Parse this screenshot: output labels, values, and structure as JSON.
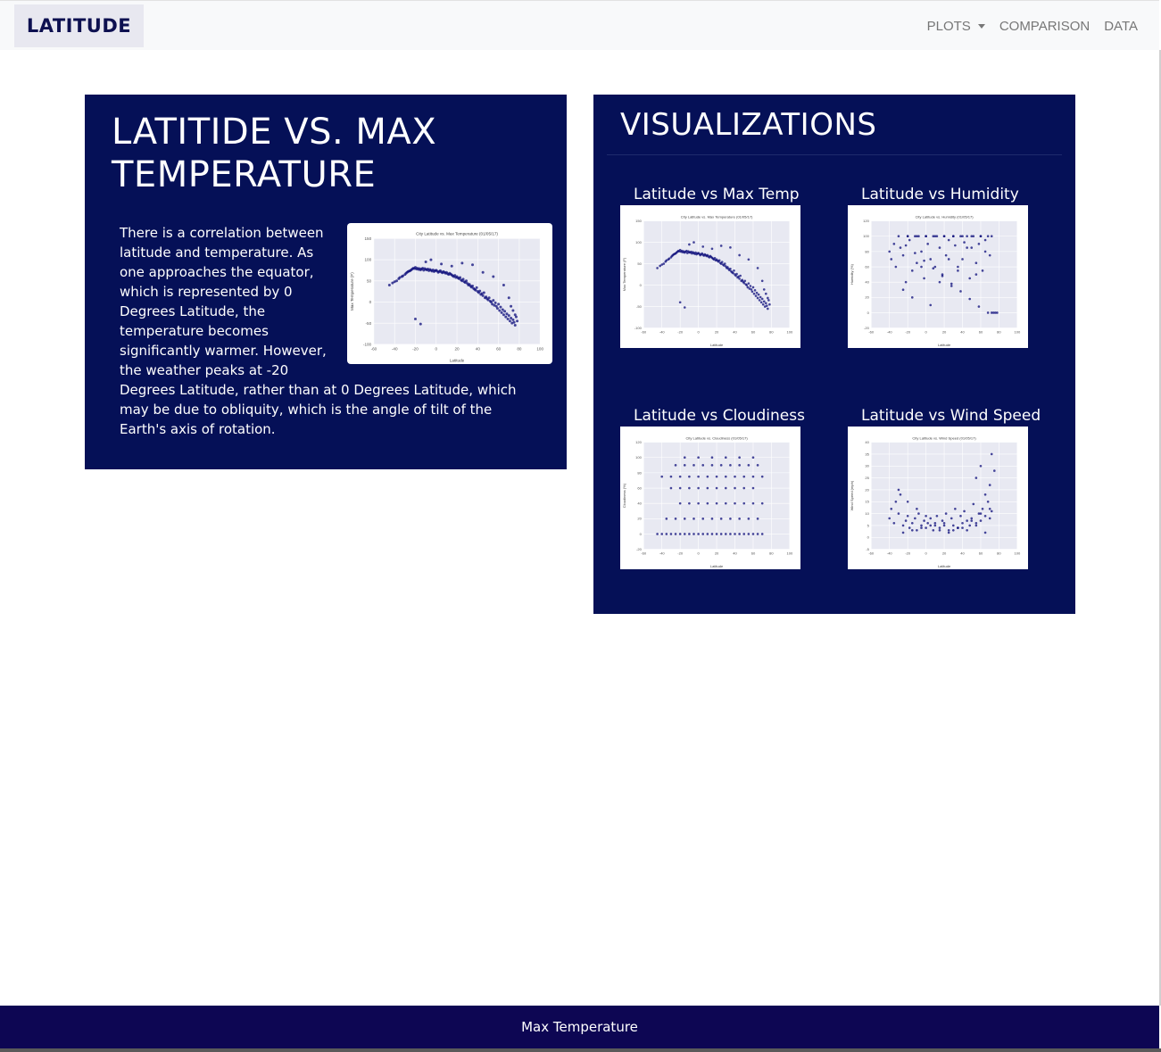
{
  "navbar": {
    "brand": "LATITUDE",
    "links": {
      "plots": "PLOTS",
      "comparison": "COMPARISON",
      "data": "DATA"
    }
  },
  "main": {
    "title": "LATITIDE VS. MAX TEMPERATURE",
    "paragraph": "There is a correlation between latitude and temperature. As one approaches the equator, which is represented by 0 Degrees Latitude, the temperature becomes significantly warmer. However, the weather peaks at -20 Degrees Latitude, rather than at 0 Degrees Latitude, which may be due to obliquity, which is the angle of tilt of the Earth's axis of rotation."
  },
  "visualizations": {
    "title": "VISUALIZATIONS",
    "thumbs": [
      {
        "label": "Latitude vs Max Temp"
      },
      {
        "label": "Latitude vs Humidity"
      },
      {
        "label": "Latitude vs Cloudiness"
      },
      {
        "label": "Latitude vs Wind Speed"
      }
    ]
  },
  "footer": {
    "text": "Max Temperature"
  },
  "colors": {
    "panel": "#051057",
    "footer": "#0d0653",
    "brand_text": "#0d1050",
    "points": "#0b0b7a"
  },
  "chart_data": [
    {
      "type": "scatter",
      "title": "City Latitude vs. Max Temperature (01/05/17)",
      "xlabel": "Latitude",
      "ylabel": "Max Temperature (F)",
      "xlim": [
        -60,
        100
      ],
      "ylim": [
        -100,
        150
      ],
      "xticks": [
        -60,
        -40,
        -20,
        0,
        20,
        40,
        60,
        80,
        100
      ],
      "yticks": [
        -100,
        -50,
        0,
        50,
        100,
        150
      ],
      "x": [
        -45,
        -42,
        -40,
        -38,
        -36,
        -35,
        -33,
        -32,
        -30,
        -29,
        -28,
        -27,
        -26,
        -25,
        -24,
        -23,
        -22,
        -21,
        -20,
        -19,
        -18,
        -17,
        -16,
        -15,
        -14,
        -13,
        -12,
        -11,
        -10,
        -9,
        -8,
        -7,
        -6,
        -5,
        -4,
        -3,
        -2,
        -1,
        0,
        1,
        2,
        3,
        4,
        5,
        6,
        7,
        8,
        9,
        10,
        11,
        12,
        13,
        14,
        15,
        16,
        17,
        18,
        19,
        20,
        21,
        22,
        23,
        24,
        25,
        26,
        27,
        28,
        29,
        30,
        31,
        32,
        33,
        34,
        35,
        36,
        37,
        38,
        39,
        40,
        41,
        42,
        43,
        44,
        45,
        46,
        47,
        48,
        49,
        50,
        51,
        52,
        53,
        54,
        55,
        56,
        57,
        58,
        59,
        60,
        61,
        62,
        63,
        64,
        65,
        66,
        67,
        68,
        69,
        70,
        71,
        72,
        73,
        74,
        75,
        76,
        77,
        78,
        -20,
        -15,
        -10,
        -5,
        5,
        15,
        25,
        35,
        45,
        55,
        65,
        70,
        72,
        74,
        76
      ],
      "y": [
        40,
        45,
        48,
        50,
        55,
        58,
        60,
        62,
        65,
        68,
        70,
        72,
        73,
        74,
        76,
        78,
        80,
        79,
        82,
        78,
        80,
        77,
        79,
        76,
        78,
        80,
        75,
        79,
        77,
        76,
        78,
        74,
        77,
        75,
        73,
        76,
        72,
        74,
        75,
        73,
        70,
        72,
        74,
        71,
        69,
        72,
        70,
        68,
        70,
        67,
        65,
        68,
        66,
        64,
        62,
        60,
        63,
        58,
        60,
        57,
        55,
        58,
        52,
        50,
        54,
        48,
        46,
        50,
        44,
        40,
        42,
        38,
        35,
        38,
        32,
        30,
        28,
        34,
        25,
        22,
        26,
        18,
        20,
        15,
        22,
        10,
        12,
        8,
        5,
        10,
        2,
        0,
        -5,
        4,
        -8,
        -2,
        -10,
        -15,
        -5,
        -20,
        -12,
        -25,
        -18,
        -30,
        -22,
        -35,
        -28,
        -40,
        -32,
        -45,
        -38,
        -50,
        -42,
        -48,
        -55,
        -35,
        -45,
        -40,
        -52,
        95,
        100,
        90,
        85,
        92,
        88,
        70,
        60,
        40,
        10,
        -10,
        -20,
        -30,
        -25,
        -40
      ]
    },
    {
      "type": "scatter",
      "title": "City Latitude vs. Humidity (01/05/17)",
      "xlabel": "Latitude",
      "ylabel": "Humidity (%)",
      "xlim": [
        -60,
        100
      ],
      "ylim": [
        -20,
        120
      ],
      "xticks": [
        -60,
        -40,
        -20,
        0,
        20,
        40,
        60,
        80,
        100
      ],
      "yticks": [
        -20,
        0,
        20,
        40,
        60,
        80,
        100,
        120
      ],
      "x": [
        -40,
        -38,
        -35,
        -33,
        -30,
        -28,
        -25,
        -22,
        -20,
        -18,
        -15,
        -12,
        -10,
        -8,
        -5,
        -2,
        0,
        2,
        5,
        8,
        10,
        12,
        15,
        18,
        20,
        22,
        25,
        28,
        30,
        32,
        35,
        38,
        40,
        42,
        45,
        48,
        50,
        52,
        55,
        58,
        60,
        62,
        65,
        68,
        70,
        72,
        -25,
        -20,
        -15,
        -10,
        -5,
        0,
        5,
        10,
        15,
        20,
        25,
        30,
        35,
        40,
        45,
        50,
        55,
        60,
        65,
        -22,
        -12,
        -2,
        8,
        18,
        28,
        38,
        48,
        58,
        68,
        72,
        74,
        76,
        78
      ],
      "y": [
        80,
        70,
        90,
        60,
        100,
        85,
        75,
        40,
        100,
        95,
        55,
        100,
        65,
        100,
        80,
        45,
        100,
        90,
        70,
        100,
        60,
        100,
        85,
        50,
        100,
        75,
        95,
        35,
        100,
        88,
        60,
        100,
        70,
        92,
        100,
        45,
        85,
        100,
        65,
        90,
        100,
        55,
        80,
        100,
        75,
        100,
        30,
        100,
        20,
        100,
        60,
        100,
        10,
        100,
        40,
        100,
        70,
        100,
        55,
        100,
        85,
        100,
        50,
        100,
        95,
        88,
        78,
        68,
        58,
        48,
        38,
        28,
        18,
        8,
        0,
        0,
        0,
        0,
        0
      ]
    },
    {
      "type": "scatter",
      "title": "City Latitude vs. Cloudiness (01/05/17)",
      "xlabel": "Latitude",
      "ylabel": "Cloudiness (%)",
      "xlim": [
        -60,
        100
      ],
      "ylim": [
        -20,
        120
      ],
      "xticks": [
        -60,
        -40,
        -20,
        0,
        20,
        40,
        60,
        80,
        100
      ],
      "yticks": [
        -20,
        0,
        20,
        40,
        60,
        80,
        100,
        120
      ],
      "x": [
        -45,
        -40,
        -35,
        -30,
        -25,
        -20,
        -15,
        -10,
        -5,
        0,
        5,
        10,
        15,
        20,
        25,
        30,
        35,
        40,
        45,
        50,
        55,
        60,
        65,
        70,
        -40,
        -30,
        -20,
        -10,
        0,
        10,
        20,
        30,
        40,
        50,
        60,
        70,
        -25,
        -15,
        -5,
        5,
        15,
        25,
        35,
        45,
        55,
        65,
        -35,
        -25,
        -15,
        -5,
        5,
        15,
        25,
        35,
        45,
        55,
        65,
        -20,
        -10,
        0,
        10,
        20,
        30,
        40,
        50,
        60,
        70,
        -30,
        -20,
        -10,
        0,
        10,
        20,
        30,
        40,
        50,
        60,
        -15,
        0,
        15,
        30,
        45,
        60
      ],
      "y": [
        0,
        0,
        0,
        0,
        0,
        0,
        0,
        0,
        0,
        0,
        0,
        0,
        0,
        0,
        0,
        0,
        0,
        0,
        0,
        0,
        0,
        0,
        0,
        0,
        75,
        75,
        75,
        75,
        75,
        75,
        75,
        75,
        75,
        75,
        75,
        75,
        90,
        90,
        90,
        90,
        90,
        90,
        90,
        90,
        90,
        90,
        20,
        20,
        20,
        20,
        20,
        20,
        20,
        20,
        20,
        20,
        20,
        40,
        40,
        40,
        40,
        40,
        40,
        40,
        40,
        40,
        40,
        60,
        60,
        60,
        60,
        60,
        60,
        60,
        60,
        60,
        60,
        100,
        100,
        100,
        100,
        100,
        100
      ]
    },
    {
      "type": "scatter",
      "title": "City Latitude vs. Wind Speed (01/05/17)",
      "xlabel": "Latitude",
      "ylabel": "Wind Speed (mph)",
      "xlim": [
        -60,
        100
      ],
      "ylim": [
        -5,
        40
      ],
      "xticks": [
        -60,
        -40,
        -20,
        0,
        20,
        40,
        60,
        80,
        100
      ],
      "yticks": [
        -5,
        0,
        5,
        10,
        15,
        20,
        25,
        30,
        35,
        40
      ],
      "x": [
        -40,
        -38,
        -35,
        -33,
        -30,
        -28,
        -25,
        -22,
        -20,
        -18,
        -15,
        -12,
        -10,
        -8,
        -5,
        -2,
        0,
        2,
        5,
        8,
        10,
        12,
        15,
        18,
        20,
        22,
        25,
        28,
        30,
        32,
        35,
        38,
        40,
        42,
        45,
        48,
        50,
        52,
        55,
        58,
        60,
        62,
        65,
        68,
        70,
        72,
        -25,
        -15,
        -5,
        5,
        15,
        25,
        35,
        45,
        55,
        65,
        -30,
        -20,
        -10,
        0,
        10,
        20,
        30,
        40,
        50,
        60,
        70,
        55,
        60,
        65,
        70,
        72,
        75
      ],
      "y": [
        8,
        12,
        6,
        15,
        10,
        18,
        5,
        7,
        9,
        4,
        6,
        8,
        3,
        10,
        5,
        7,
        4,
        6,
        8,
        3,
        5,
        9,
        4,
        7,
        6,
        10,
        3,
        8,
        5,
        12,
        4,
        9,
        6,
        11,
        7,
        5,
        8,
        14,
        6,
        10,
        7,
        12,
        9,
        15,
        8,
        11,
        2,
        3,
        4,
        5,
        3,
        2,
        4,
        3,
        5,
        2,
        20,
        15,
        12,
        9,
        6,
        5,
        3,
        4,
        7,
        10,
        12,
        25,
        30,
        18,
        22,
        35,
        28
      ]
    }
  ]
}
